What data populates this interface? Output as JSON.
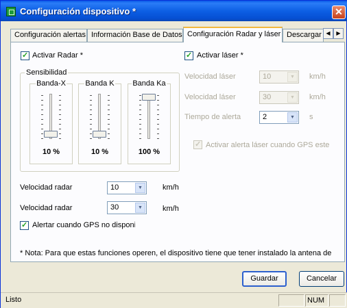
{
  "window": {
    "title": "Configuración dispositivo *",
    "close_glyph": "✕"
  },
  "tabs": [
    {
      "label": "Configuración alertas",
      "active": false
    },
    {
      "label": "Información Base de Datos",
      "active": false
    },
    {
      "label": "Configuración Radar y láser",
      "active": true
    },
    {
      "label": "Descargar",
      "active": false
    }
  ],
  "tab_scroll": {
    "left": "◀",
    "right": "▶"
  },
  "radar": {
    "activate_label": "Activar Radar *",
    "activate_checked": true,
    "sensitivity": {
      "title": "Sensibilidad",
      "bands": [
        {
          "name": "Banda-X",
          "percent_label": "10 %",
          "level": 0.1
        },
        {
          "name": "Banda K",
          "percent_label": "10 %",
          "level": 0.1
        },
        {
          "name": "Banda Ka",
          "percent_label": "100 %",
          "level": 1.0
        }
      ]
    },
    "speed_rows": [
      {
        "label": "Velocidad radar",
        "value": "10",
        "unit": "km/h"
      },
      {
        "label": "Velocidad radar",
        "value": "30",
        "unit": "km/h"
      }
    ],
    "gps_alert_label": "Alertar cuando GPS no disponi",
    "gps_alert_checked": true
  },
  "laser": {
    "activate_label": "Activar láser *",
    "activate_checked": true,
    "rows": [
      {
        "label": "Velocidad láser",
        "value": "10",
        "unit": "km/h",
        "enabled": false
      },
      {
        "label": "Velocidad láser",
        "value": "30",
        "unit": "km/h",
        "enabled": false
      },
      {
        "label": "Tiempo de alerta",
        "value": "2",
        "unit": "s",
        "enabled": true
      }
    ],
    "gps_alert_label": "Activar alerta láser cuando GPS este",
    "gps_alert_checked": true
  },
  "note": "* Nota: Para que estas funciones operen, el dispositivo tiene que tener instalado la antena de",
  "buttons": {
    "save": "Guardar",
    "cancel": "Cancelar"
  },
  "statusbar": {
    "status": "Listo",
    "num": "NUM"
  },
  "dropdown_glyph": "▼"
}
